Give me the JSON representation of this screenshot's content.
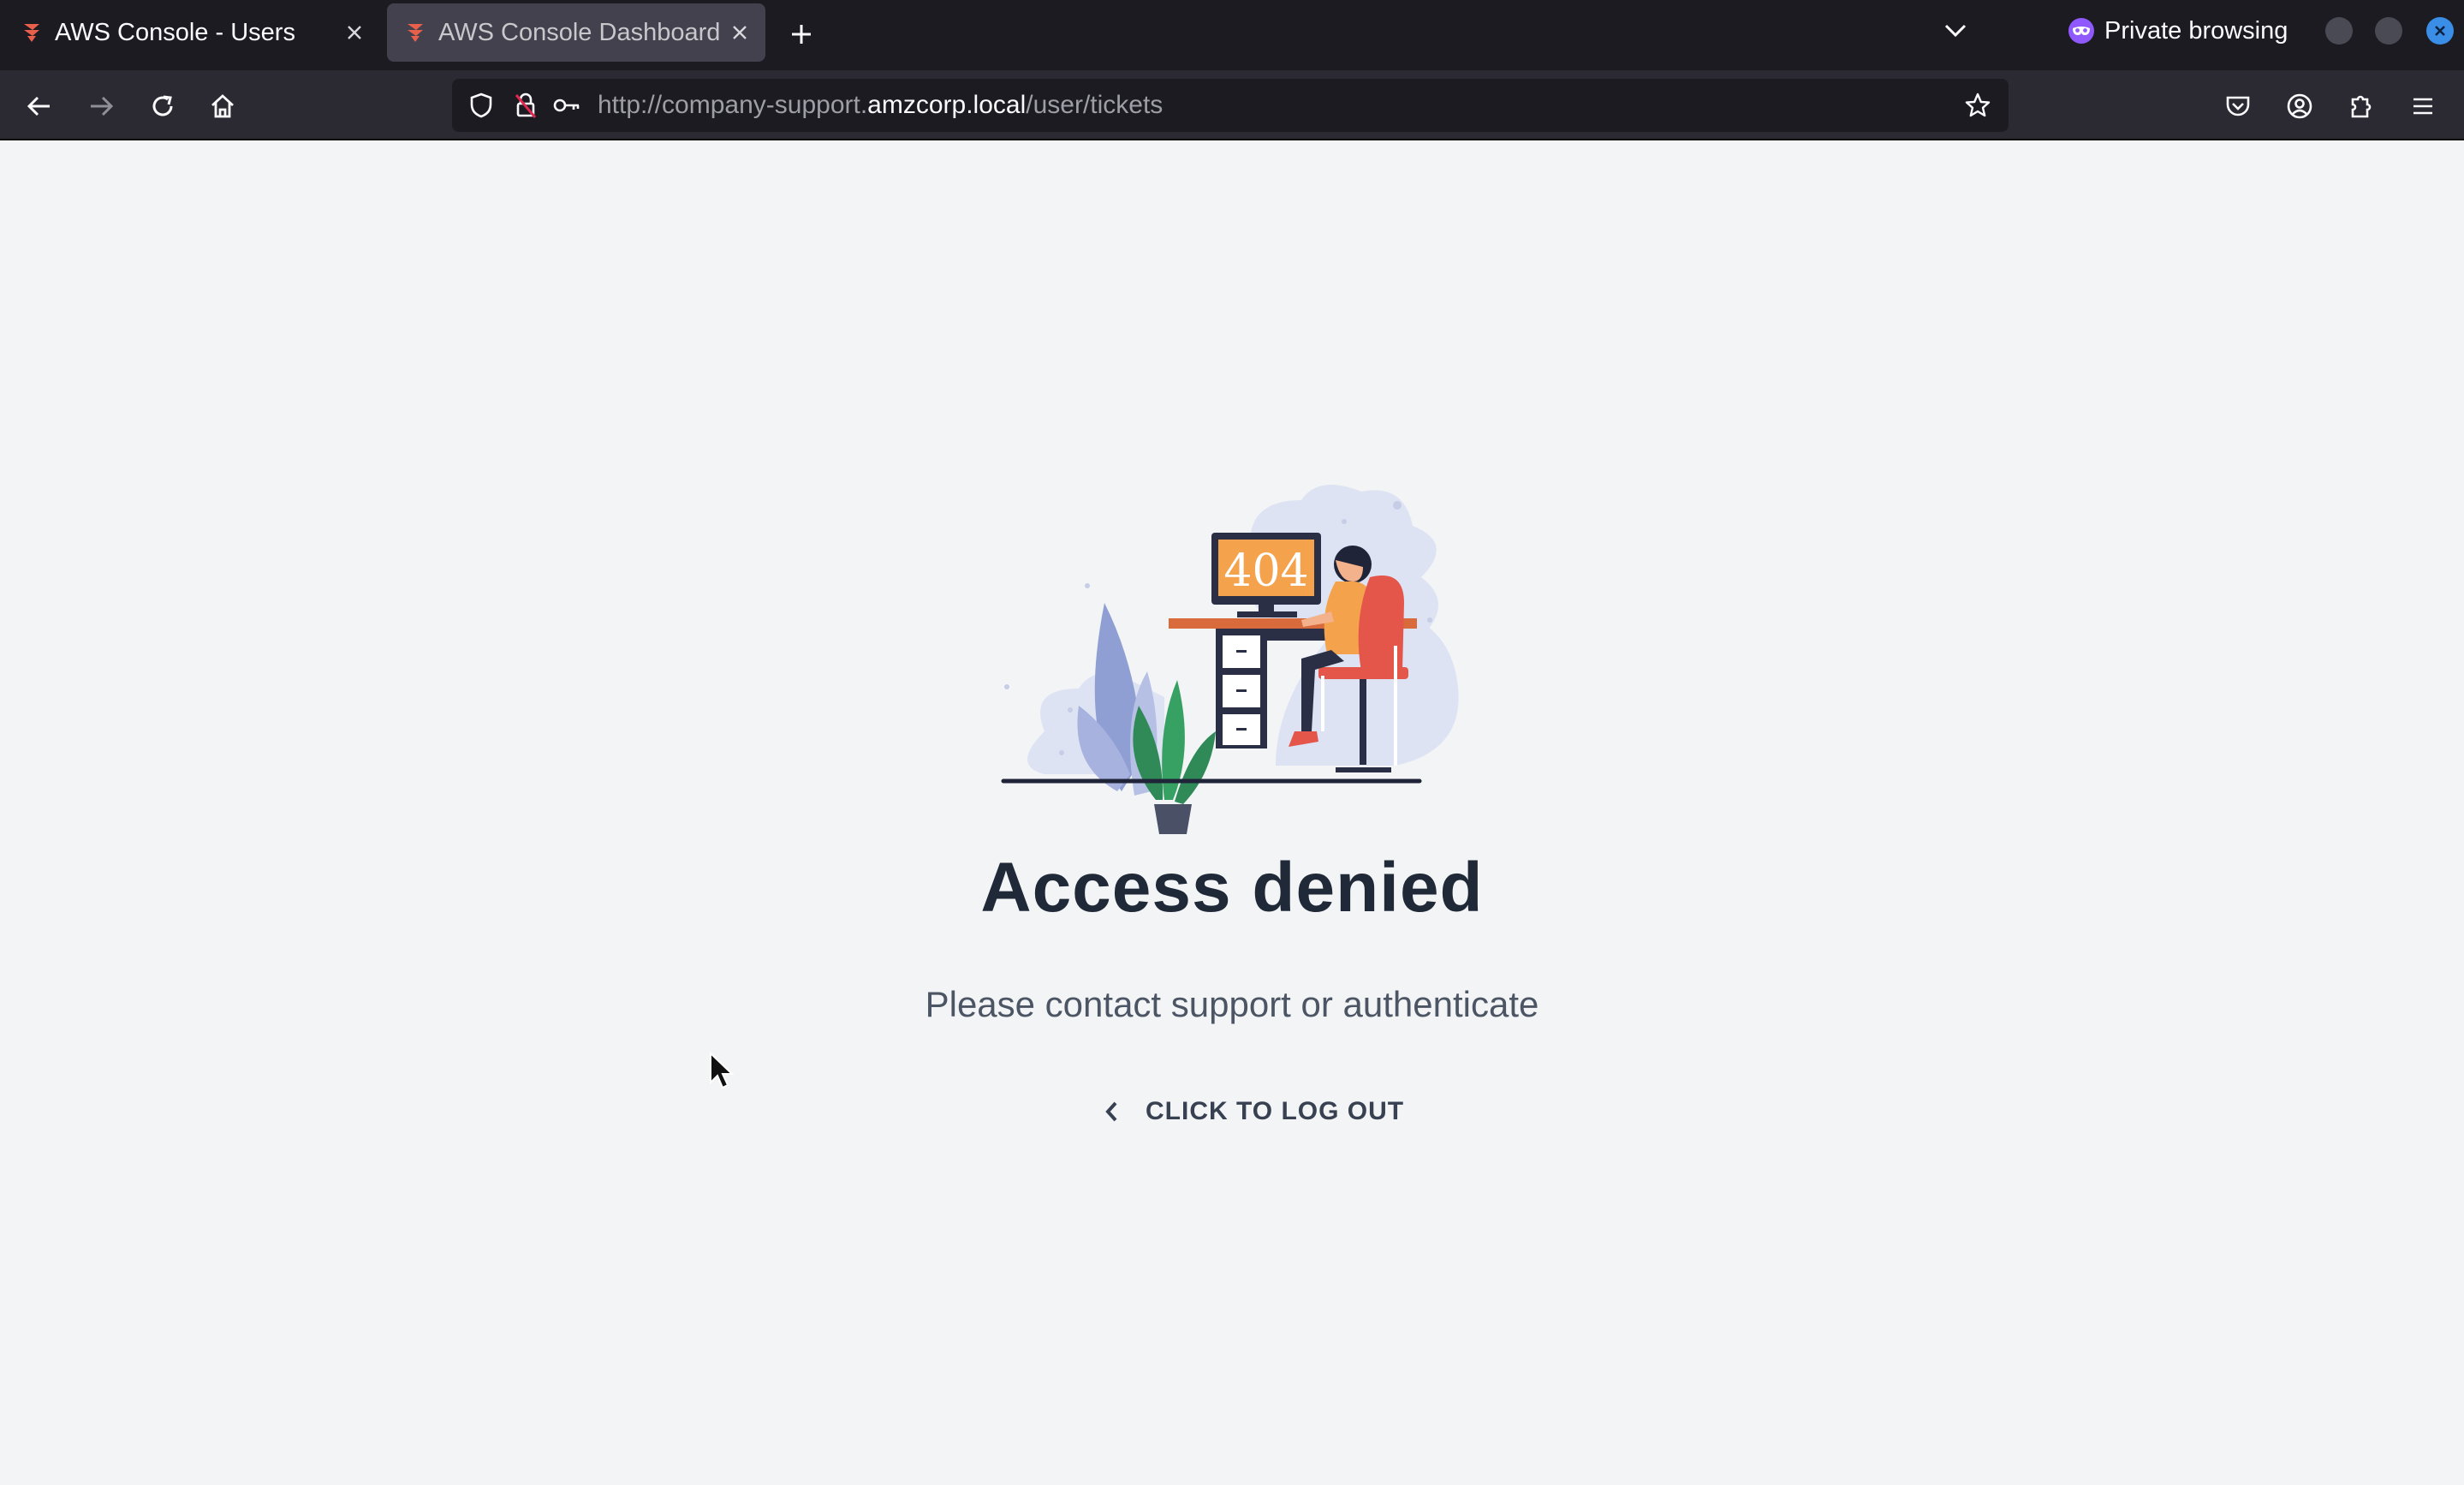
{
  "browser": {
    "tabs": [
      {
        "title": "AWS Console - Users",
        "active": false
      },
      {
        "title": "AWS Console Dashboard",
        "active": true
      }
    ],
    "private_label": "Private browsing",
    "url": {
      "prefix": "http://company-support.",
      "domain": "amzcorp.local",
      "path": "/user/tickets"
    }
  },
  "page": {
    "illustration_text": "404",
    "heading": "Access denied",
    "subtitle": "Please contact support or authenticate",
    "logout_label": "CLICK TO LOG OUT"
  },
  "colors": {
    "tab_bar": "#1c1b22",
    "nav_bar": "#2b2a33",
    "page_bg": "#f3f4f6",
    "heading": "#1f2937",
    "favicon": "#e8604c",
    "private_icon": "#9059ff",
    "window_close": "#3a8ee6"
  }
}
